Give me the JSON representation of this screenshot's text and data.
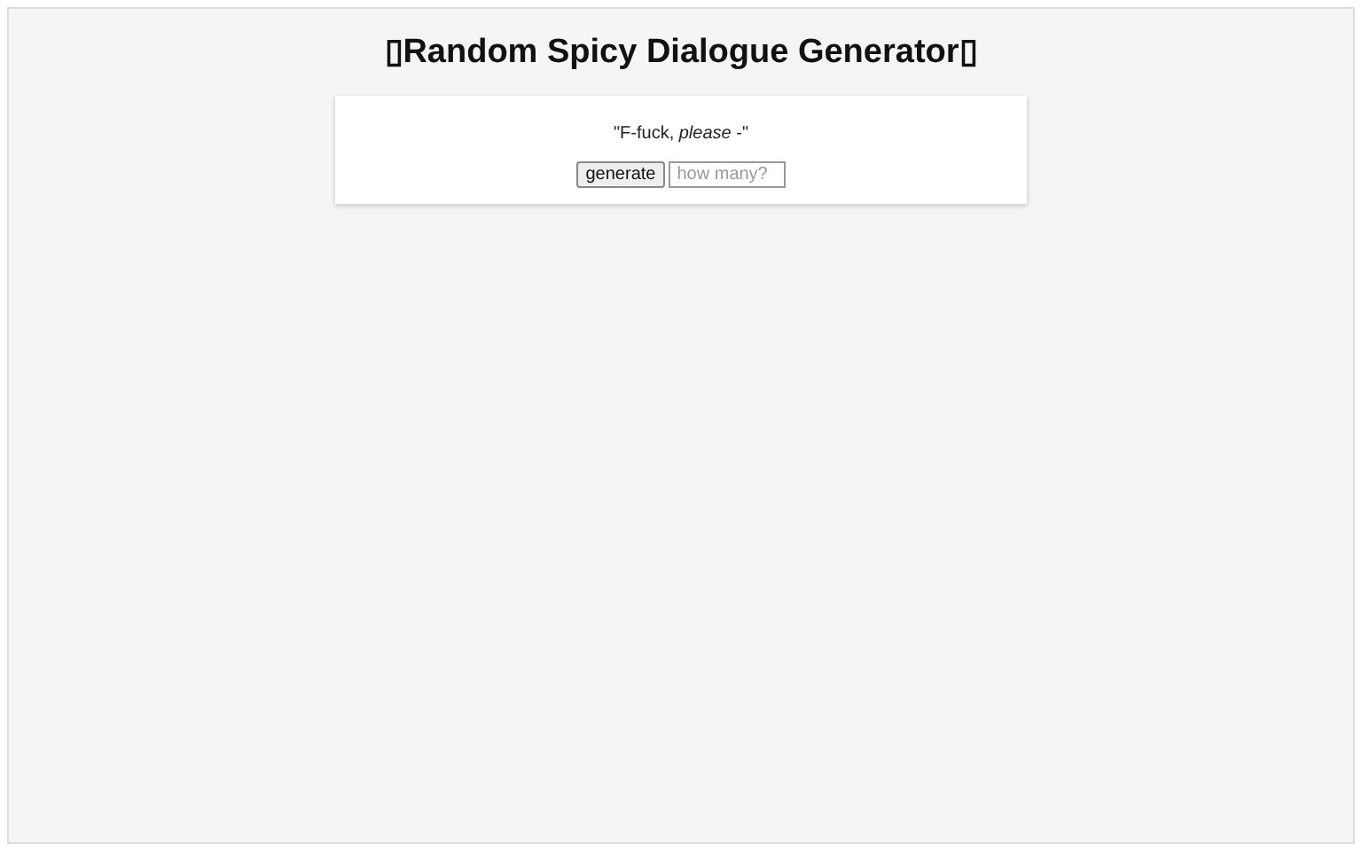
{
  "title": "▯Random Spicy Dialogue Generator▯",
  "dialogue": "\"F-fuck, *please* -\"",
  "generate_button": "generate",
  "count_field": {
    "placeholder": "how many?"
  }
}
